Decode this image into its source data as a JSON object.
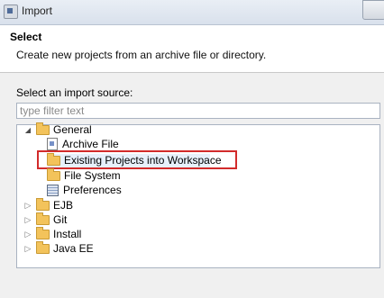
{
  "window": {
    "title": "Import"
  },
  "header": {
    "title": "Select",
    "description": "Create new projects from an archive file or directory."
  },
  "source": {
    "label": "Select an import source:",
    "filter_placeholder": "type filter text"
  },
  "tree": {
    "general": {
      "label": "General",
      "children": [
        {
          "label": "Archive File",
          "icon": "archive-file-icon"
        },
        {
          "label": "Existing Projects into Workspace",
          "icon": "open-folder-icon",
          "selected": true
        },
        {
          "label": "File System",
          "icon": "folder-icon"
        },
        {
          "label": "Preferences",
          "icon": "preferences-icon"
        }
      ]
    },
    "categories": [
      {
        "label": "EJB"
      },
      {
        "label": "Git"
      },
      {
        "label": "Install"
      },
      {
        "label": "Java EE"
      }
    ]
  },
  "colors": {
    "highlight_border": "#d22b2b",
    "folder": "#f3c35b"
  }
}
